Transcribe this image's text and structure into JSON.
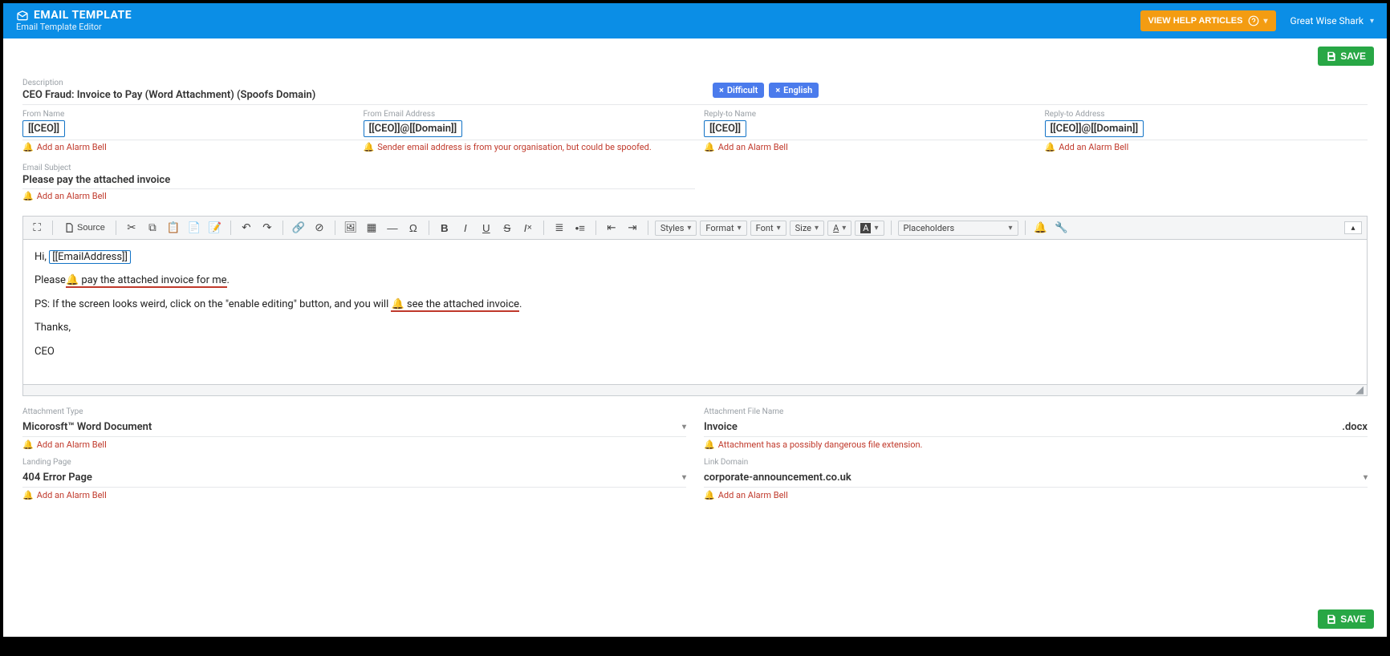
{
  "header": {
    "title": "EMAIL TEMPLATE",
    "subtitle": "Email Template Editor",
    "help_label": "VIEW HELP ARTICLES",
    "user_name": "Great Wise Shark"
  },
  "actions": {
    "save_label": "SAVE"
  },
  "desc_row": {
    "description_label": "Description",
    "description_value": "CEO Fraud: Invoice to Pay (Word Attachment) (Spoofs Domain)",
    "tags": [
      {
        "label": "Difficult"
      },
      {
        "label": "English"
      }
    ]
  },
  "from_row": {
    "from_name_label": "From Name",
    "from_name_value": "[[CEO]]",
    "from_email_label": "From Email Address",
    "from_email_value": "[[CEO]]@[[Domain]]",
    "replyto_name_label": "Reply-to Name",
    "replyto_name_value": "[[CEO]]",
    "replyto_addr_label": "Reply-to Address",
    "replyto_addr_value": "[[CEO]]@[[Domain]]"
  },
  "alarm_add": "Add an Alarm Bell",
  "alarm_spoof": "Sender email address is from your organisation, but could be spoofed.",
  "subject_label": "Email Subject",
  "subject_value": "Please pay the attached invoice",
  "toolbar": {
    "source": "Source",
    "styles": "Styles",
    "format": "Format",
    "font": "Font",
    "size": "Size",
    "placeholders": "Placeholders"
  },
  "body": {
    "line1_pre": "Hi, ",
    "line1_ph": "[[EmailAddress]]",
    "line2_pre": "Please",
    "line2_red": "  pay the attached invoice for me",
    "line2_post": ".",
    "line3_pre": "PS: If the screen looks weird, click on the \"enable editing\" button, and you will ",
    "line3_red": "  see the attached invoice",
    "line3_post": ".",
    "line4": "Thanks,",
    "line5": "CEO"
  },
  "lower": {
    "att_type_label": "Attachment Type",
    "att_type_value": "Micorosft™ Word Document",
    "att_file_label": "Attachment File Name",
    "att_file_value": "Invoice",
    "att_file_ext": ".docx",
    "att_file_alarm": "Attachment has a possibly dangerous file extension.",
    "landing_label": "Landing Page",
    "landing_value": "404 Error Page",
    "linkdom_label": "Link Domain",
    "linkdom_value": "corporate-announcement.co.uk"
  }
}
